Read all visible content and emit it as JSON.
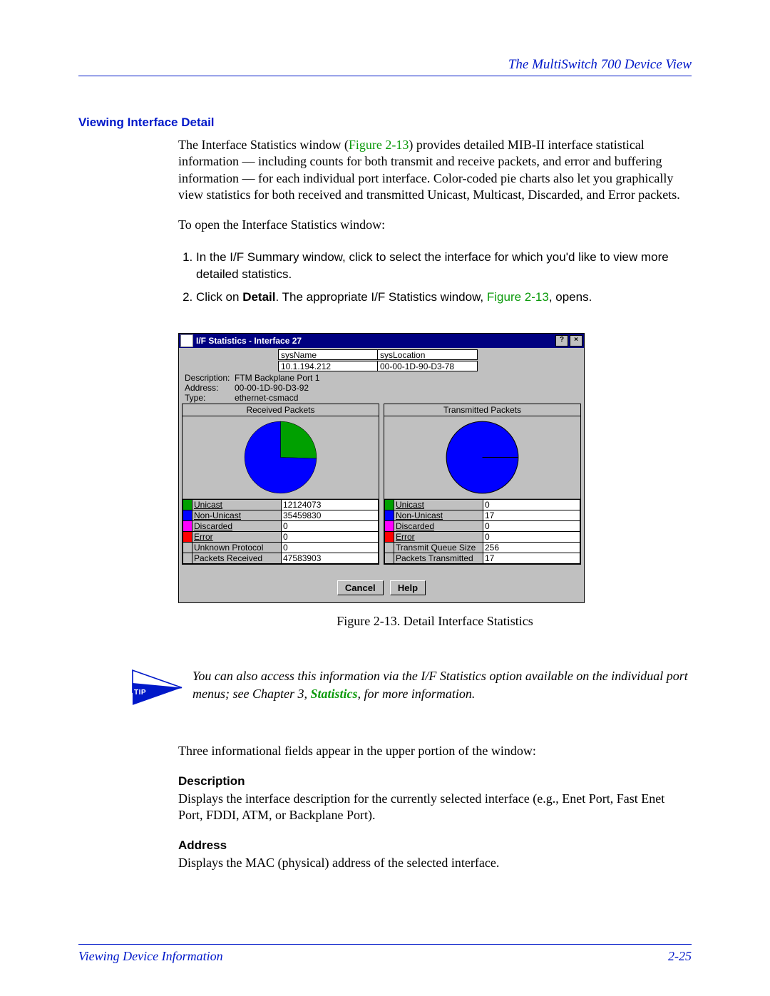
{
  "header": {
    "title": "The MultiSwitch 700 Device View"
  },
  "section_heading": "Viewing Interface Detail",
  "para1_a": "The Interface Statistics window (",
  "para1_fig": "Figure 2-13",
  "para1_b": ") provides detailed MIB-II interface statistical information — including counts for both transmit and receive packets, and error and buffering information — for each individual port interface. Color-coded pie charts also let you graphically view statistics for both received and transmitted Unicast, Multicast, Discarded, and Error packets.",
  "para2": "To open the Interface Statistics window:",
  "step1": "In the I/F Summary window, click to select the interface for which you'd like to view more detailed statistics.",
  "step2_a": "Click on ",
  "step2_bold": "Detail",
  "step2_b": ". The appropriate I/F Statistics window, ",
  "step2_fig": "Figure 2-13",
  "step2_c": ", opens.",
  "dialog": {
    "title": "I/F Statistics - Interface 27",
    "help_icon": "?",
    "close_icon": "×",
    "sysname_label": "sysName",
    "syslocation_label": "sysLocation",
    "ip": "10.1.194.212",
    "mac": "00-00-1D-90-D3-78",
    "desc_label": "Description:",
    "desc_val": "FTM Backplane Port 1",
    "addr_label": "Address:",
    "addr_val": "00-00-1D-90-D3-92",
    "type_label": "Type:",
    "type_val": "ethernet-csmacd",
    "rx_title": "Received Packets",
    "tx_title": "Transmitted Packets",
    "rx_rows": [
      {
        "c": "#00a000",
        "l": "Unicast",
        "v": "12124073"
      },
      {
        "c": "#0000ff",
        "l": "Non-Unicast",
        "v": "35459830"
      },
      {
        "c": "#ff00ff",
        "l": "Discarded",
        "v": "0"
      },
      {
        "c": "#ff0000",
        "l": "Error",
        "v": "0"
      },
      {
        "c": "",
        "l": "Unknown Protocol",
        "v": "0",
        "nou": true
      },
      {
        "c": "",
        "l": "Packets Received",
        "v": "47583903",
        "nou": true
      }
    ],
    "tx_rows": [
      {
        "c": "#00a000",
        "l": "Unicast",
        "v": "0"
      },
      {
        "c": "#0000ff",
        "l": "Non-Unicast",
        "v": "17"
      },
      {
        "c": "#ff00ff",
        "l": "Discarded",
        "v": "0"
      },
      {
        "c": "#ff0000",
        "l": "Error",
        "v": "0"
      },
      {
        "c": "",
        "l": "Transmit Queue Size",
        "v": "256",
        "nou": true
      },
      {
        "c": "",
        "l": "Packets Transmitted",
        "v": "17",
        "nou": true
      }
    ],
    "cancel": "Cancel",
    "help": "Help"
  },
  "caption": "Figure 2-13.  Detail Interface Statistics",
  "tip_label": "TIP",
  "tip_a": "You can also access this information via the I/F Statistics option available on the individual port menus; see Chapter 3, ",
  "tip_link": "Statistics",
  "tip_b": ", for more information.",
  "para3": "Three informational fields appear in the upper portion of the window:",
  "desc_head": "Description",
  "desc_body": "Displays the interface description for the currently selected interface (e.g., Enet Port, Fast Enet Port, FDDI, ATM, or Backplane Port).",
  "addr_head": "Address",
  "addr_body": "Displays the MAC (physical) address of the selected interface.",
  "footer": {
    "left": "Viewing Device Information",
    "right": "2-25"
  },
  "chart_data": [
    {
      "type": "pie",
      "title": "Received Packets",
      "series": [
        {
          "name": "Unicast",
          "value": 12124073,
          "color": "#00a000"
        },
        {
          "name": "Non-Unicast",
          "value": 35459830,
          "color": "#0000ff"
        },
        {
          "name": "Discarded",
          "value": 0,
          "color": "#ff00ff"
        },
        {
          "name": "Error",
          "value": 0,
          "color": "#ff0000"
        }
      ]
    },
    {
      "type": "pie",
      "title": "Transmitted Packets",
      "series": [
        {
          "name": "Unicast",
          "value": 0,
          "color": "#00a000"
        },
        {
          "name": "Non-Unicast",
          "value": 17,
          "color": "#0000ff"
        },
        {
          "name": "Discarded",
          "value": 0,
          "color": "#ff00ff"
        },
        {
          "name": "Error",
          "value": 0,
          "color": "#ff0000"
        }
      ]
    }
  ]
}
